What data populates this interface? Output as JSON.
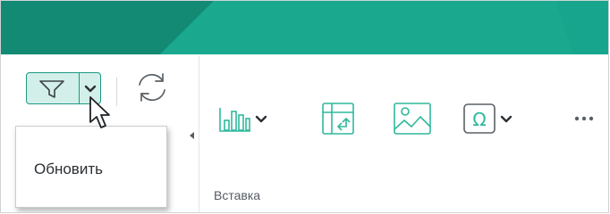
{
  "colors": {
    "header_bg": "#17a68d",
    "header_dark": "#128a74",
    "accent": "#1c9a82",
    "accent_fill": "#d3efe9",
    "icon_accent": "#2fb99c",
    "icon_gray": "#5a6166"
  },
  "toolbar": {
    "filter_button": {
      "icon": "filter-icon",
      "dropdown_icon": "chevron-down-icon",
      "state": "active"
    },
    "refresh_button": {
      "icon": "refresh-icon"
    },
    "chart_button": {
      "icon": "bar-chart-icon",
      "has_dropdown": true
    },
    "table_button": {
      "icon": "pivot-table-icon"
    },
    "image_button": {
      "icon": "image-icon"
    },
    "symbol_button": {
      "icon": "omega-icon",
      "symbol": "Ω",
      "has_dropdown": true
    },
    "more_button": {
      "icon": "more-horizontal-icon"
    },
    "collapse_button": {
      "icon": "triangle-left-icon"
    }
  },
  "groups": {
    "insert_label": "Вставка"
  },
  "tooltip": {
    "text": "Обновить"
  },
  "cursor": {
    "icon": "mouse-pointer-icon"
  }
}
